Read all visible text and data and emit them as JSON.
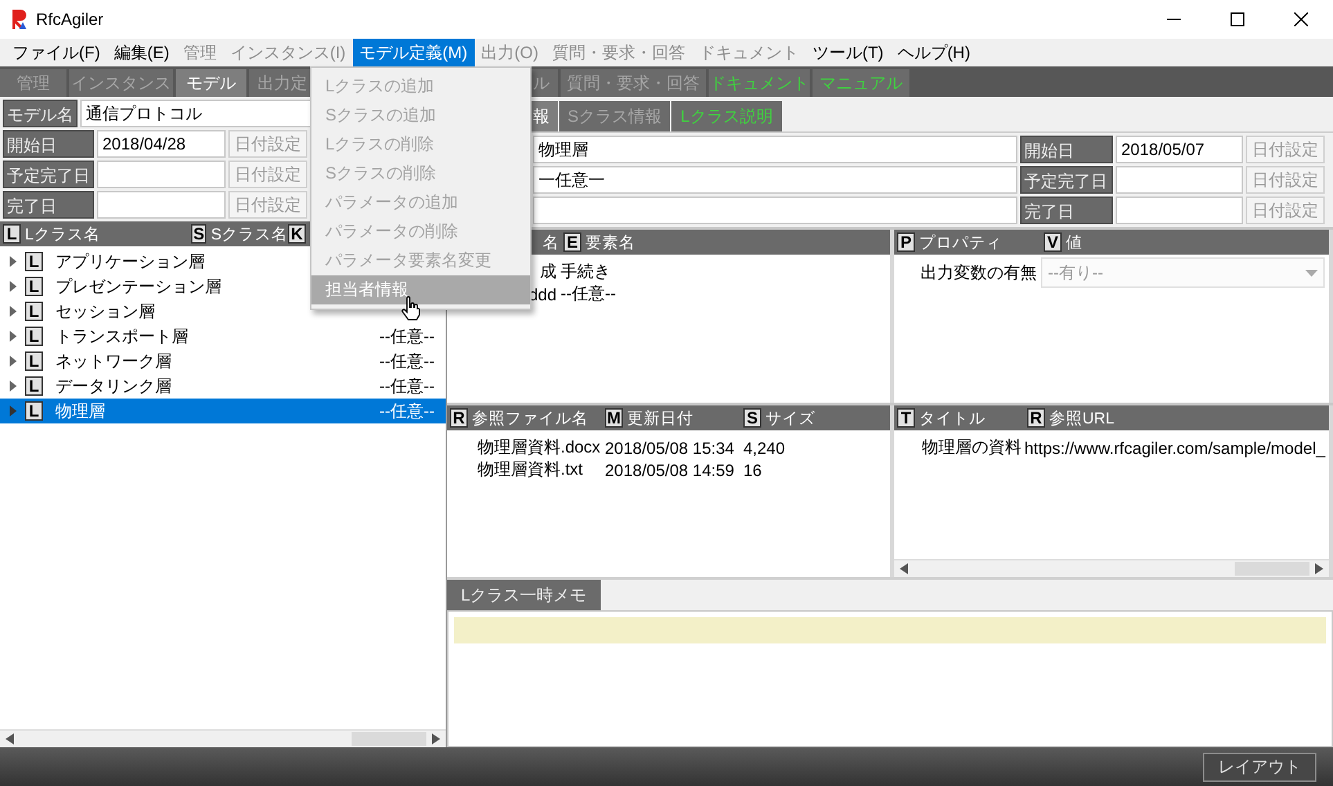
{
  "window": {
    "title": "RfcAgiler"
  },
  "menubar": [
    {
      "label": "ファイル(F)",
      "disabled": false,
      "selected": false
    },
    {
      "label": "編集(E)",
      "disabled": false,
      "selected": false
    },
    {
      "label": "管理",
      "disabled": true,
      "selected": false
    },
    {
      "label": "インスタンス(I)",
      "disabled": true,
      "selected": false
    },
    {
      "label": "モデル定義(M)",
      "disabled": false,
      "selected": true
    },
    {
      "label": "出力(O)",
      "disabled": true,
      "selected": false
    },
    {
      "label": "質問・要求・回答",
      "disabled": true,
      "selected": false
    },
    {
      "label": "ドキュメント",
      "disabled": true,
      "selected": false
    },
    {
      "label": "ツール(T)",
      "disabled": false,
      "selected": false
    },
    {
      "label": "ヘルプ(H)",
      "disabled": false,
      "selected": false
    }
  ],
  "open_menu": {
    "items": [
      {
        "label": "Lクラスの追加",
        "hovered": false
      },
      {
        "label": "Sクラスの追加",
        "hovered": false
      },
      {
        "label": "Lクラスの削除",
        "hovered": false
      },
      {
        "label": "Sクラスの削除",
        "hovered": false
      },
      {
        "label": "パラメータの追加",
        "hovered": false
      },
      {
        "label": "パラメータの削除",
        "hovered": false
      },
      {
        "label": "パラメータ要素名変更",
        "hovered": false
      },
      {
        "label": "担当者情報",
        "hovered": true
      }
    ]
  },
  "main_tabs": [
    {
      "label": "管理",
      "selected": false,
      "disabled": true,
      "accent": false
    },
    {
      "label": "インスタンス",
      "selected": false,
      "disabled": true,
      "accent": false
    },
    {
      "label": "モデル",
      "selected": true,
      "disabled": false,
      "accent": false
    },
    {
      "label": "出力定",
      "selected": false,
      "disabled": true,
      "accent": false
    },
    {
      "label": "ル",
      "selected": false,
      "disabled": true,
      "accent": false
    },
    {
      "label": "質問・要求・回答",
      "selected": false,
      "disabled": true,
      "accent": false
    },
    {
      "label": "ドキュメント",
      "selected": false,
      "disabled": false,
      "accent": true
    },
    {
      "label": "マニュアル",
      "selected": false,
      "disabled": false,
      "accent": true
    }
  ],
  "model": {
    "name_label": "モデル名",
    "name": "通信プロトコル",
    "dates": [
      {
        "label": "開始日",
        "value": "2018/04/28",
        "button": "日付設定"
      },
      {
        "label": "予定完了日",
        "button": "日付設定"
      },
      {
        "label": "完了日",
        "button": "日付設定"
      }
    ]
  },
  "tree": {
    "columns": [
      {
        "badge": "L",
        "label": "Lクラス名"
      },
      {
        "badge": "S",
        "label": "Sクラス名"
      },
      {
        "badge": "K"
      }
    ],
    "rows": [
      {
        "badge": "L",
        "name": "アプリケーション層",
        "selected": false
      },
      {
        "badge": "L",
        "name": "プレゼンテーション層",
        "selected": false
      },
      {
        "badge": "L",
        "name": "セッション層",
        "selected": false
      },
      {
        "badge": "L",
        "name": "トランスポート層",
        "value": "--任意--",
        "selected": false
      },
      {
        "badge": "L",
        "name": "ネットワーク層",
        "value": "--任意--",
        "selected": false
      },
      {
        "badge": "L",
        "name": "データリンク層",
        "value": "--任意--",
        "selected": false
      },
      {
        "badge": "L",
        "name": "物理層",
        "value": "--任意--",
        "selected": true
      }
    ]
  },
  "detail": {
    "tabs": [
      {
        "label": "報",
        "selected": true,
        "disabled": false,
        "accent": false
      },
      {
        "label": "Sクラス情報",
        "selected": false,
        "disabled": true,
        "accent": false
      },
      {
        "label": "Lクラス説明",
        "selected": false,
        "disabled": false,
        "accent": true
      }
    ],
    "fields": [
      {
        "value": "物理層"
      },
      {
        "value": "一任意一"
      }
    ],
    "dates": [
      {
        "label": "開始日",
        "value": "2018/05/07",
        "button": "日付設定"
      },
      {
        "label": "予定完了日",
        "button": "日付設定"
      },
      {
        "label": "完了日",
        "button": "日付設定"
      }
    ]
  },
  "elements": {
    "columns": [
      {
        "label": "名"
      },
      {
        "badge": "E",
        "label": "要素名"
      }
    ],
    "rows": [
      [
        "成",
        "手続き"
      ],
      [
        "ddd",
        "--任意--"
      ]
    ]
  },
  "properties": {
    "columns": [
      {
        "badge": "P",
        "label": "プロパティ"
      },
      {
        "badge": "V",
        "label": "値"
      }
    ],
    "rows": [
      {
        "name": "出力変数の有無",
        "value": "--有り--",
        "disabled": true
      }
    ]
  },
  "files": {
    "columns": [
      {
        "badge": "R",
        "label": "参照ファイル名"
      },
      {
        "badge": "M",
        "label": "更新日付"
      },
      {
        "badge": "S",
        "label": "サイズ"
      }
    ],
    "rows": [
      [
        "物理層資料.docx",
        "2018/05/08 15:34",
        "4,240"
      ],
      [
        "物理層資料.txt",
        "2018/05/08 14:59",
        "16"
      ]
    ]
  },
  "links": {
    "columns": [
      {
        "badge": "T",
        "label": "タイトル"
      },
      {
        "badge": "R",
        "label": "参照URL"
      }
    ],
    "rows": [
      [
        "物理層の資料",
        "https://www.rfcagiler.com/sample/model_"
      ]
    ]
  },
  "memo": {
    "tab": "Lクラス一時メモ"
  },
  "status_bar": {
    "button": "レイアウト"
  }
}
